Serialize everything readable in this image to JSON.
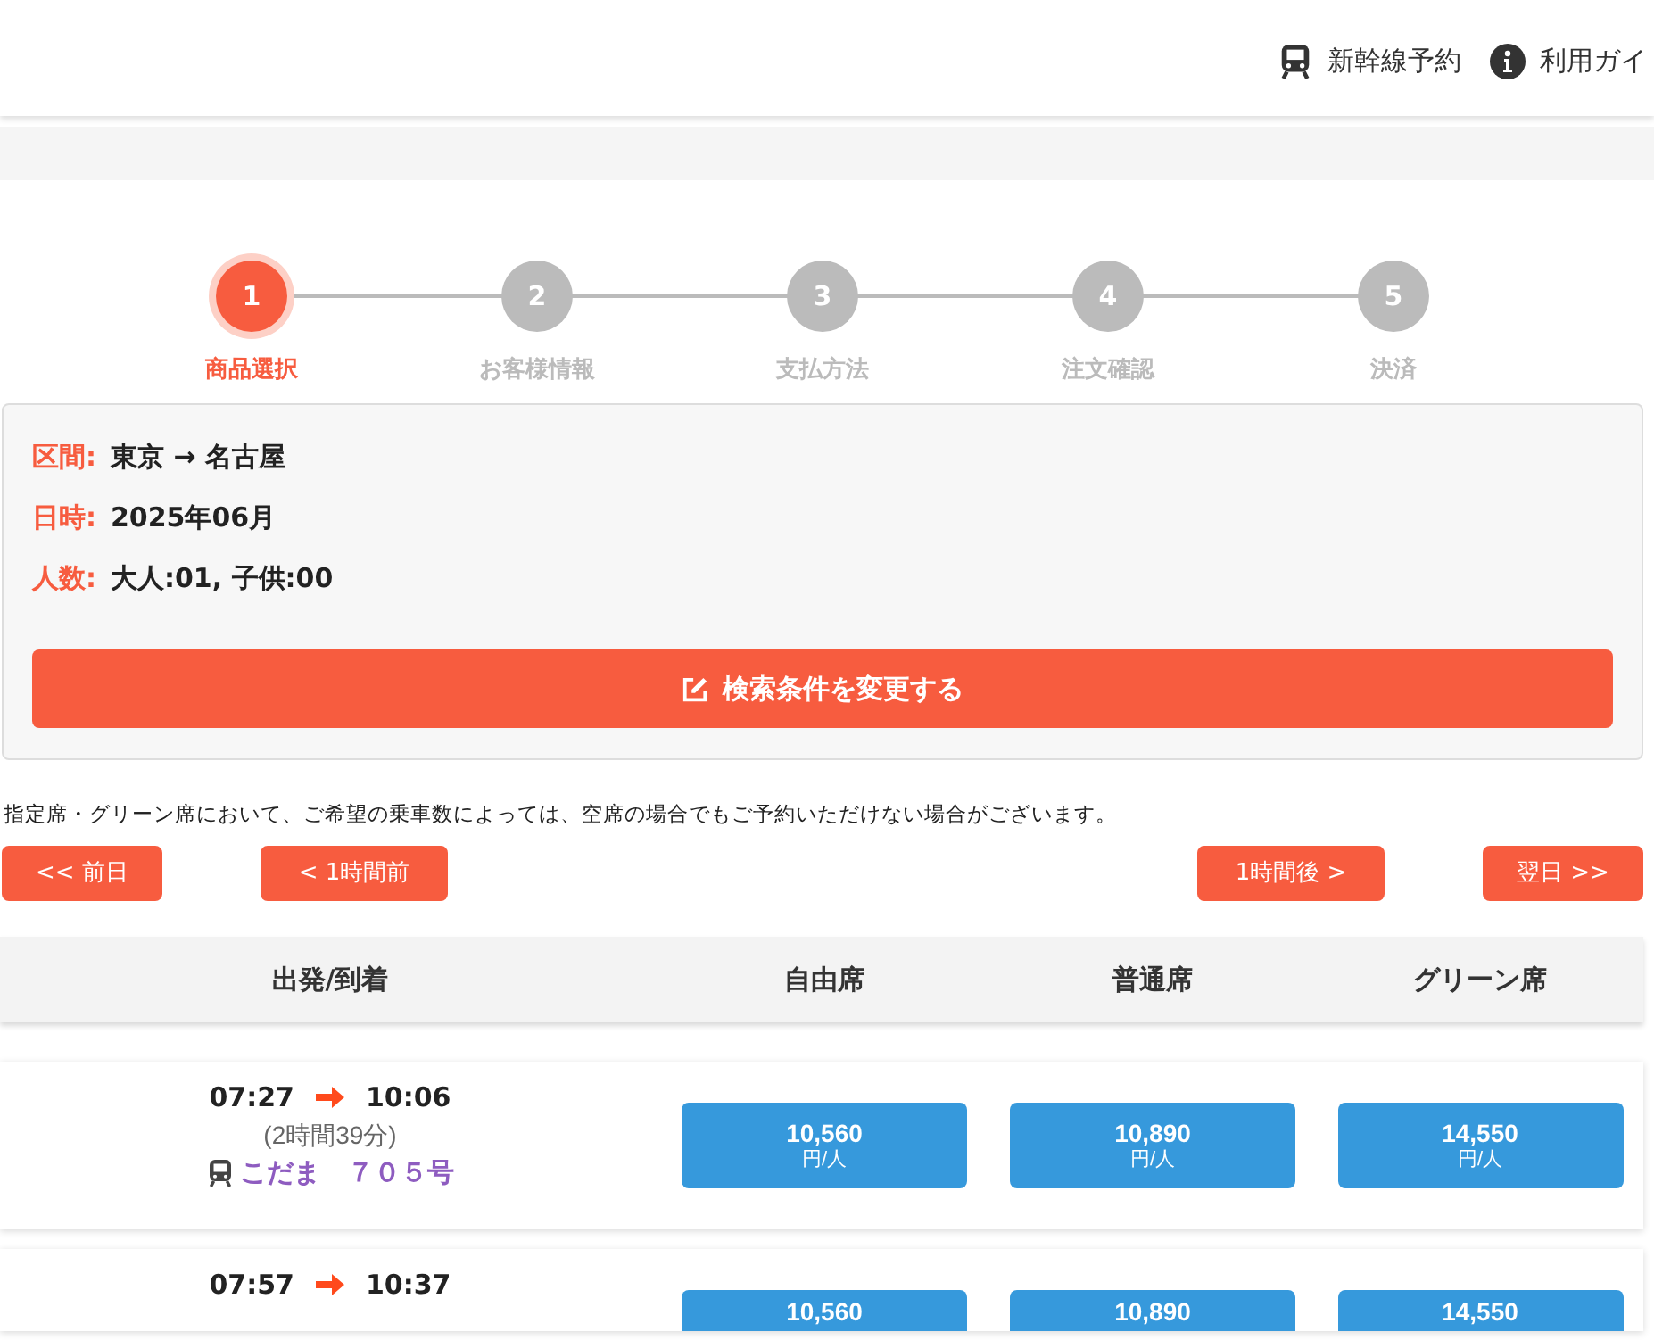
{
  "header": {
    "links": [
      {
        "kind": "train",
        "label": "新幹線予約"
      },
      {
        "kind": "info",
        "label": "利用ガイ"
      }
    ]
  },
  "steps": [
    {
      "number": "1",
      "label": "商品選択",
      "selected": true
    },
    {
      "number": "2",
      "label": "お客様情報",
      "selected": false
    },
    {
      "number": "3",
      "label": "支払方法",
      "selected": false
    },
    {
      "number": "4",
      "label": "注文確認",
      "selected": false
    },
    {
      "number": "5",
      "label": "決済",
      "selected": false
    }
  ],
  "search_summary": {
    "fields": [
      {
        "label": "区間:",
        "value": "東京 → 名古屋"
      },
      {
        "label": "日時:",
        "value": "2025年06月"
      },
      {
        "label": "人数:",
        "value": "大人:01, 子供:00"
      }
    ],
    "change_button": "検索条件を変更する"
  },
  "notice": "指定席・グリーン席において、ご希望の乗車数によっては、空席の場合でもご予約いただけない場合がございます。",
  "nav_buttons": [
    "<< 前日",
    "< 1時間前",
    "1時間後 >",
    "翌日 >>"
  ],
  "table": {
    "columns": [
      "出発/到着",
      "自由席",
      "普通席",
      "グリーン席"
    ],
    "rows": [
      {
        "depart": "07:27",
        "arrive": "10:06",
        "duration": "(2時間39分)",
        "train": "こだま　７０５号",
        "prices": [
          {
            "amount": "10,560",
            "unit": "円/人"
          },
          {
            "amount": "10,890",
            "unit": "円/人"
          },
          {
            "amount": "14,550",
            "unit": "円/人"
          }
        ]
      },
      {
        "depart": "07:57",
        "arrive": "10:37",
        "prices": [
          {
            "amount": "10,560"
          },
          {
            "amount": "10,890"
          },
          {
            "amount": "14,550"
          }
        ]
      }
    ]
  }
}
